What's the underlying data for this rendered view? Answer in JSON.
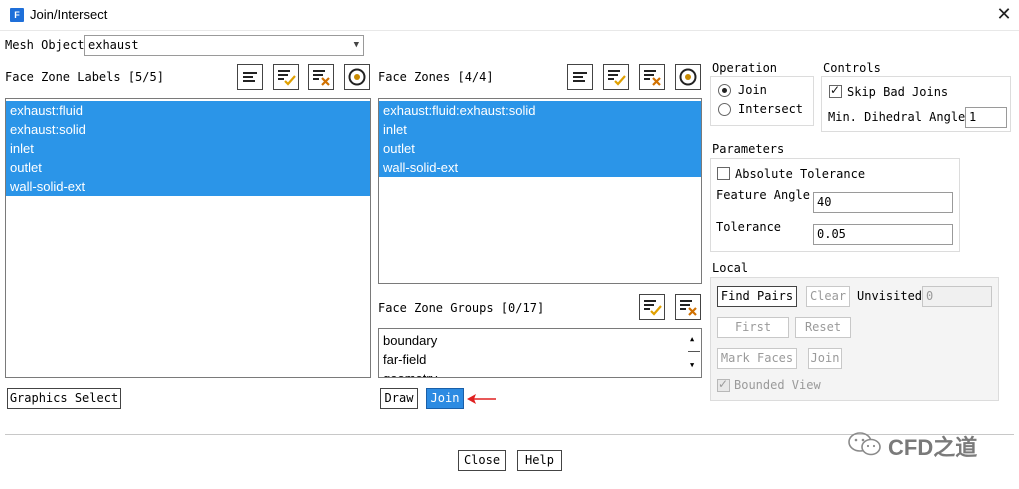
{
  "window": {
    "title": "Join/Intersect",
    "app_icon_letter": "F",
    "close_glyph": "✕"
  },
  "mesh_object": {
    "label": "Mesh Object",
    "value": "exhaust"
  },
  "face_zone_labels": {
    "header": "Face Zone Labels [5/5]",
    "items": [
      "exhaust:fluid",
      "exhaust:solid",
      "inlet",
      "outlet",
      "wall-solid-ext"
    ],
    "graphics_select_label": "Graphics Select"
  },
  "face_zones": {
    "header": "Face Zones [4/4]",
    "items": [
      "exhaust:fluid:exhaust:solid",
      "inlet",
      "outlet",
      "wall-solid-ext"
    ]
  },
  "face_zone_groups": {
    "header": "Face Zone Groups [0/17]",
    "items": [
      "boundary",
      "far-field",
      "geometry"
    ]
  },
  "actions": {
    "draw_label": "Draw",
    "join_label": "Join"
  },
  "operation": {
    "title": "Operation",
    "join_label": "Join",
    "intersect_label": "Intersect",
    "selected": "Join"
  },
  "controls": {
    "title": "Controls",
    "skip_bad_joins_label": "Skip Bad Joins",
    "skip_bad_joins": true,
    "min_dihedral_label": "Min. Dihedral Angle",
    "min_dihedral_value": "1"
  },
  "parameters": {
    "title": "Parameters",
    "absolute_tolerance_label": "Absolute Tolerance",
    "absolute_tolerance": false,
    "feature_angle_label": "Feature Angle",
    "feature_angle_value": "40",
    "tolerance_label": "Tolerance",
    "tolerance_value": "0.05"
  },
  "local": {
    "title": "Local",
    "find_pairs_label": "Find Pairs",
    "clear_label": "Clear",
    "unvisited_label": "Unvisited",
    "unvisited_value": "0",
    "first_label": "First",
    "reset_label": "Reset",
    "mark_faces_label": "Mark Faces",
    "join_label": "Join",
    "bounded_view_label": "Bounded View",
    "bounded_view": true
  },
  "footer": {
    "close_label": "Close",
    "help_label": "Help"
  },
  "watermark": {
    "text": "CFD之道"
  },
  "colors": {
    "selection": "#2b95e8",
    "primary_button": "#2c8be2",
    "arrow": "#e02020",
    "accent_check": "#e0a000",
    "accent_x": "#d07000"
  }
}
